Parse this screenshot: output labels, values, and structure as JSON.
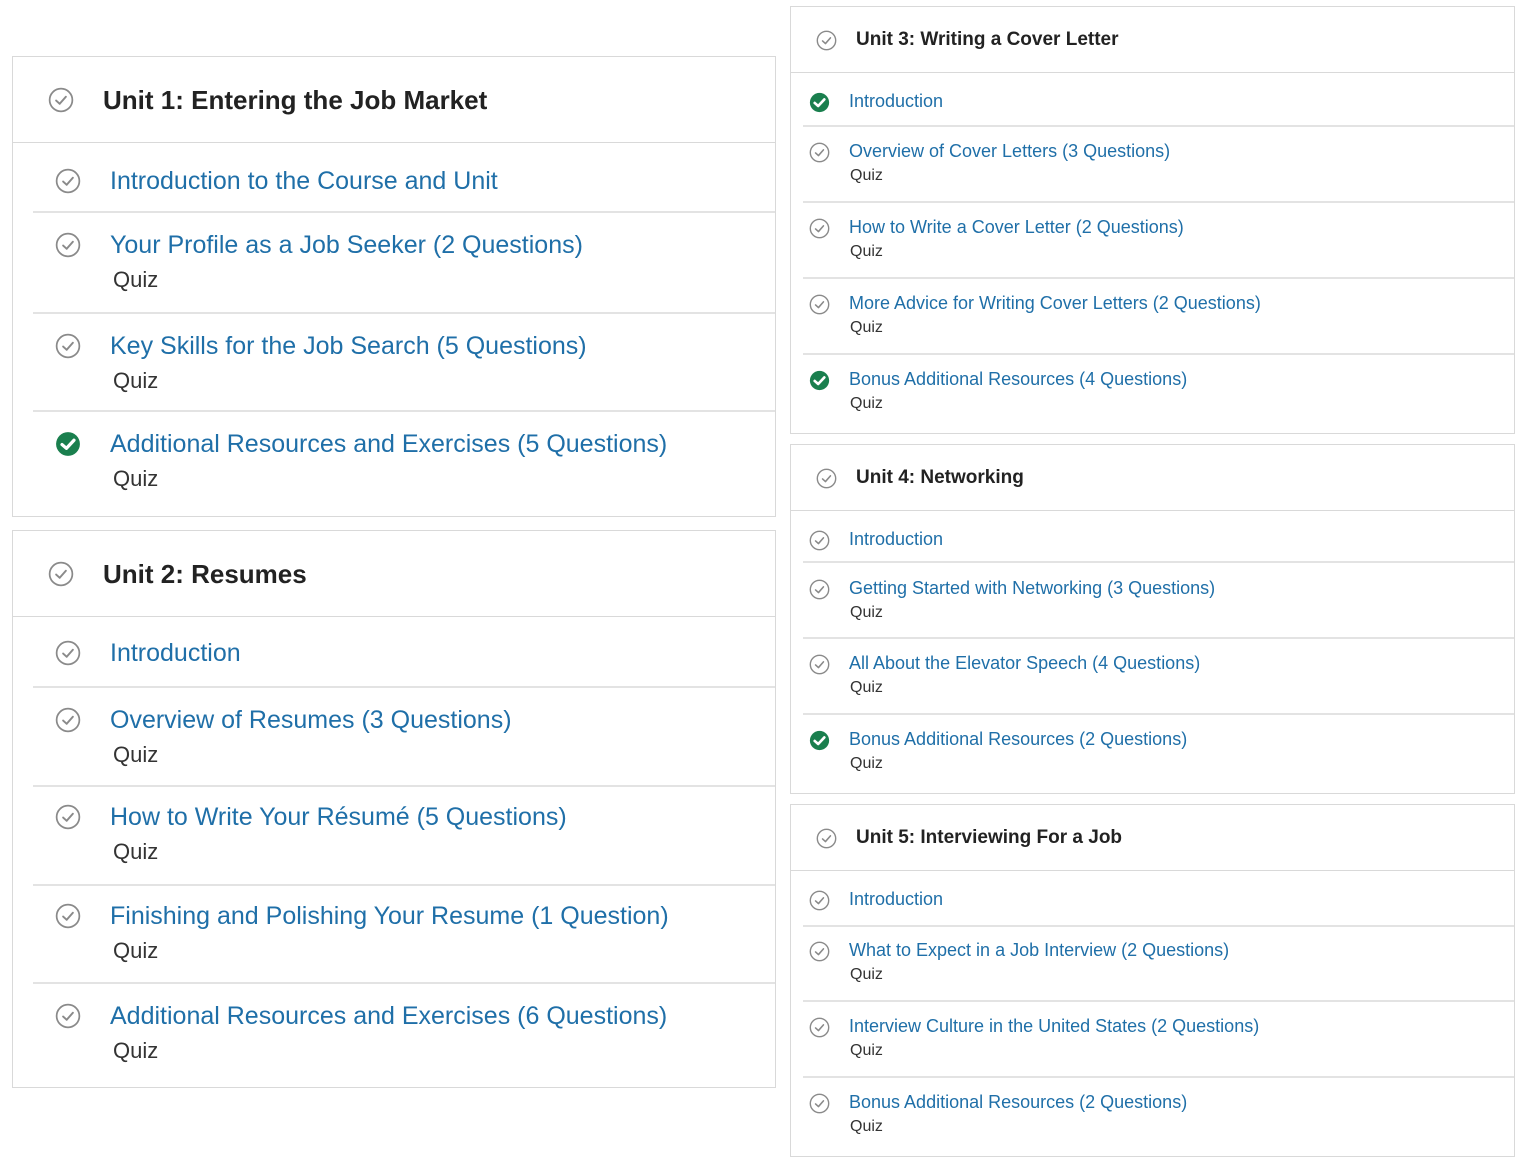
{
  "colors": {
    "link": "#1f6fa8",
    "heading": "#222222",
    "done": "#1a7f4e",
    "pending": "#8a8a8a",
    "border": "#d9d9d9"
  },
  "icons": {
    "pending": "circle-check-outline-icon",
    "done": "circle-check-filled-icon"
  },
  "units": [
    {
      "title": "Unit 1: Entering the Job Market",
      "status": "pending",
      "items": [
        {
          "title": "Introduction to the Course and Unit",
          "subtitle": "",
          "status": "pending"
        },
        {
          "title": "Your Profile as a Job Seeker (2 Questions)",
          "subtitle": "Quiz",
          "status": "pending"
        },
        {
          "title": "Key Skills for the Job Search (5 Questions)",
          "subtitle": "Quiz",
          "status": "pending"
        },
        {
          "title": "Additional Resources and Exercises (5 Questions)",
          "subtitle": "Quiz",
          "status": "done"
        }
      ]
    },
    {
      "title": "Unit 2: Resumes",
      "status": "pending",
      "items": [
        {
          "title": "Introduction",
          "subtitle": "",
          "status": "pending"
        },
        {
          "title": "Overview of Resumes (3 Questions)",
          "subtitle": "Quiz",
          "status": "pending"
        },
        {
          "title": "How to Write Your Résumé (5 Questions)",
          "subtitle": "Quiz",
          "status": "pending"
        },
        {
          "title": "Finishing and Polishing Your Resume (1 Question)",
          "subtitle": "Quiz",
          "status": "pending"
        },
        {
          "title": "Additional Resources and Exercises (6 Questions)",
          "subtitle": "Quiz",
          "status": "pending"
        }
      ]
    },
    {
      "title": "Unit 3: Writing a Cover Letter",
      "status": "pending",
      "items": [
        {
          "title": "Introduction",
          "subtitle": "",
          "status": "done"
        },
        {
          "title": "Overview of Cover Letters (3 Questions)",
          "subtitle": "Quiz",
          "status": "pending"
        },
        {
          "title": "How to Write a Cover Letter (2 Questions)",
          "subtitle": "Quiz",
          "status": "pending"
        },
        {
          "title": "More Advice for Writing Cover Letters (2 Questions)",
          "subtitle": "Quiz",
          "status": "pending"
        },
        {
          "title": "Bonus Additional Resources (4 Questions)",
          "subtitle": "Quiz",
          "status": "done"
        }
      ]
    },
    {
      "title": "Unit 4: Networking",
      "status": "pending",
      "items": [
        {
          "title": "Introduction",
          "subtitle": "",
          "status": "pending"
        },
        {
          "title": "Getting Started with Networking (3 Questions)",
          "subtitle": "Quiz",
          "status": "pending"
        },
        {
          "title": "All About the Elevator Speech (4 Questions)",
          "subtitle": "Quiz",
          "status": "pending"
        },
        {
          "title": "Bonus Additional Resources (2 Questions)",
          "subtitle": "Quiz",
          "status": "done"
        }
      ]
    },
    {
      "title": "Unit 5: Interviewing For a Job",
      "status": "pending",
      "items": [
        {
          "title": "Introduction",
          "subtitle": "",
          "status": "pending"
        },
        {
          "title": "What to Expect in a Job Interview (2 Questions)",
          "subtitle": "Quiz",
          "status": "pending"
        },
        {
          "title": "Interview Culture in the United States (2 Questions)",
          "subtitle": "Quiz",
          "status": "pending"
        },
        {
          "title": "Bonus Additional Resources (2 Questions)",
          "subtitle": "Quiz",
          "status": "pending"
        }
      ]
    }
  ]
}
